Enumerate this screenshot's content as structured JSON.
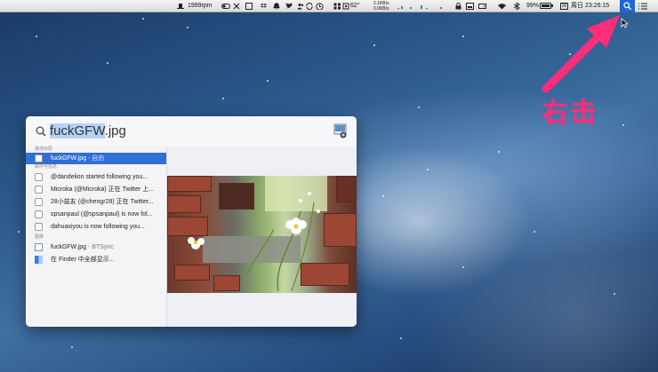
{
  "menubar": {
    "rpm": "1999rpm",
    "temperature": "62°",
    "net_up": "2.1KB/s",
    "net_down": "0.0KB/s",
    "battery": "99%",
    "calendar_day": "26",
    "clock": "周日 23:26:15"
  },
  "annotation": {
    "label": "右击",
    "color": "#ff2d7a"
  },
  "spotlight": {
    "query_selected": "fuckGFW",
    "query_rest": ".jpg",
    "sections": [
      {
        "header": "最佳匹配",
        "items": [
          {
            "title": "fuckGFW.jpg",
            "sub": "- 自由",
            "icon": "image-doc-icon",
            "selected": true
          }
        ]
      },
      {
        "header": "邮件与信息",
        "items": [
          {
            "title": "@dandelion started following you...",
            "sub": "",
            "icon": "mail-icon"
          },
          {
            "title": "Microka (@Microka) 正在 Twitter 上...",
            "sub": "",
            "icon": "mail-icon"
          },
          {
            "title": "28小兹友 (@chengr28) 正在 Twitter...",
            "sub": "",
            "icon": "mail-icon"
          },
          {
            "title": "spsanpaul (@spsanpaul) is now fol...",
            "sub": "",
            "icon": "mail-icon"
          },
          {
            "title": "dahuaxiyou is now following you...",
            "sub": "",
            "icon": "mail-icon"
          }
        ]
      },
      {
        "header": "图像",
        "items": [
          {
            "title": "fuckGFW.jpg",
            "sub": "- BTSync",
            "icon": "image-doc-icon"
          },
          {
            "title": "在 Finder 中全部显示...",
            "sub": "",
            "icon": "finder-icon"
          }
        ]
      }
    ]
  },
  "colors": {
    "selection": "#2f6fd6",
    "spotlight_button": "#1f67d4",
    "text_selection": "#b3d3f7"
  }
}
